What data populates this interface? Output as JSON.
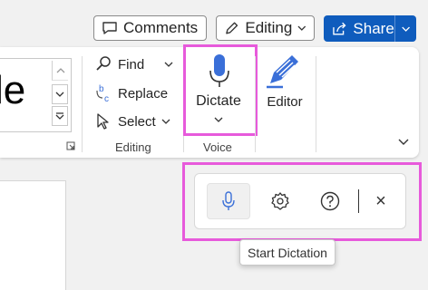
{
  "topbar": {
    "comments_label": "Comments",
    "editing_label": "Editing",
    "share_label": "Share"
  },
  "styles": {
    "preview_text": "le"
  },
  "editing_group": {
    "find_label": "Find",
    "replace_label": "Replace",
    "select_label": "Select",
    "group_label": "Editing"
  },
  "voice_group": {
    "dictate_label": "Dictate",
    "group_label": "Voice"
  },
  "editor": {
    "label": "Editor"
  },
  "dictation_toolbar": {
    "tooltip": "Start Dictation",
    "close_glyph": "×"
  },
  "colors": {
    "highlight": "#e75adb",
    "share_bg": "#0f5cbd",
    "accent_blue": "#3a6fd8"
  }
}
